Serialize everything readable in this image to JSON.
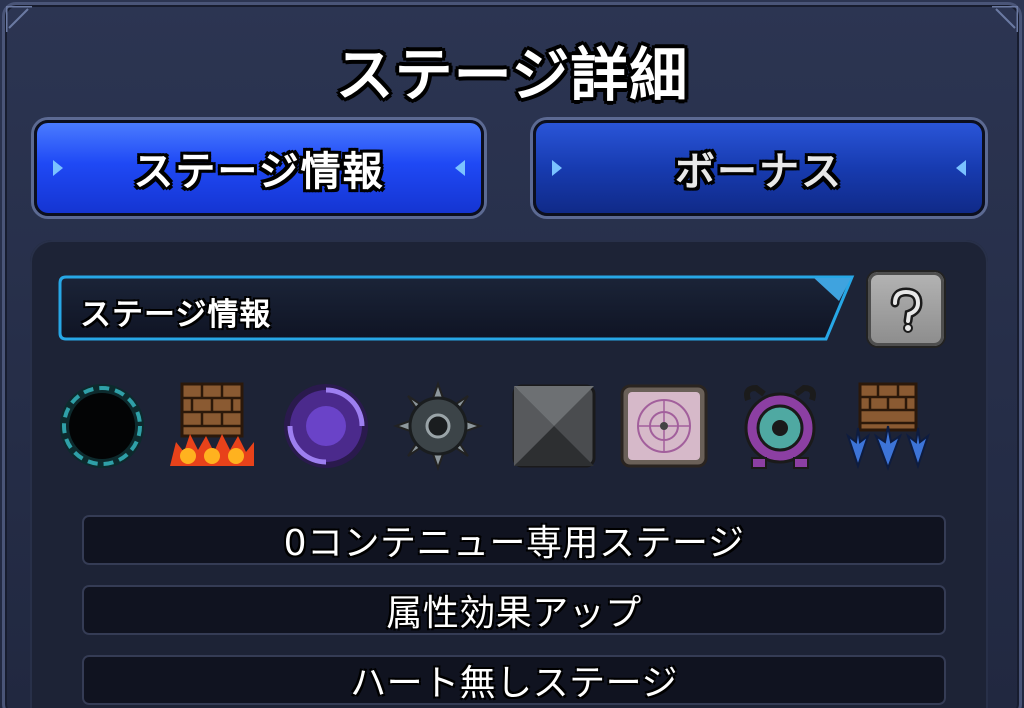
{
  "screen": {
    "title": "ステージ詳細"
  },
  "tabs": [
    {
      "label": "ステージ情報",
      "active": true
    },
    {
      "label": "ボーナス",
      "active": false
    }
  ],
  "info_bar": {
    "label": "ステージ情報",
    "help_icon": "question-mark-icon"
  },
  "gimmick_icons": [
    {
      "name": "black-hole-icon"
    },
    {
      "name": "damage-wall-icon"
    },
    {
      "name": "warp-icon"
    },
    {
      "name": "mine-icon"
    },
    {
      "name": "block-icon"
    },
    {
      "name": "magic-circle-icon"
    },
    {
      "name": "shield-unit-icon"
    },
    {
      "name": "gravity-barrier-icon"
    }
  ],
  "stage_notes": [
    {
      "text": "0コンテニュー専用ステージ"
    },
    {
      "text": "属性効果アップ"
    },
    {
      "text": "ハート無しステージ"
    }
  ],
  "colors": {
    "tab_active": "#1f49f5",
    "tab_inactive": "#173bb0",
    "panel_bg": "#1d2336",
    "info_bar_border": "#27a7e6"
  }
}
